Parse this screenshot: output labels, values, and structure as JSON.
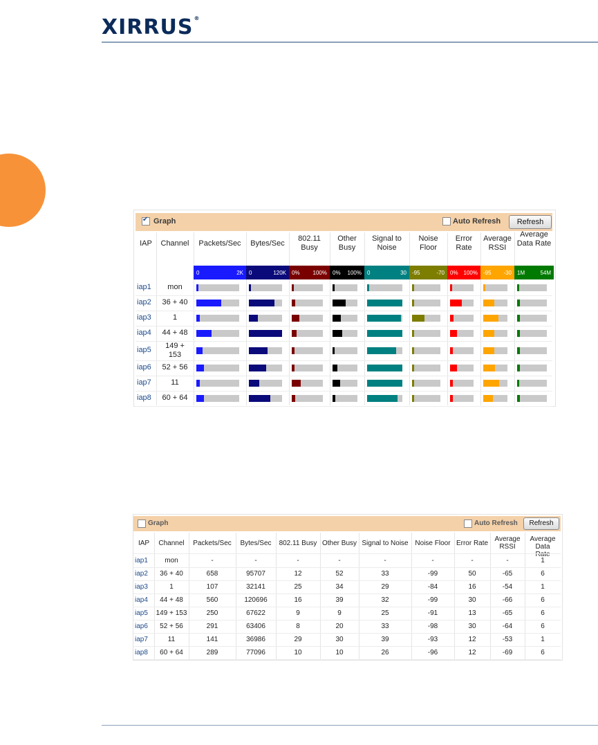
{
  "brand": {
    "name": "XIRRUS",
    "mark": "®"
  },
  "graph_panel": {
    "graph_label": "Graph",
    "graph_checked": true,
    "auto_refresh_label": "Auto Refresh",
    "refresh_label": "Refresh",
    "columns": [
      "IAP",
      "Channel",
      "Packets/Sec",
      "Bytes/Sec",
      "802.11 Busy",
      "Other Busy",
      "Signal to Noise",
      "Noise Floor",
      "Error Rate",
      "Average RSSI",
      "Average Data Rate"
    ],
    "scales": [
      {
        "min": "0",
        "max": "2K",
        "color": "#1a1aff"
      },
      {
        "min": "0",
        "max": "120K",
        "color": "#0a0a7a"
      },
      {
        "min": "0%",
        "max": "100%",
        "color": "#7a0000"
      },
      {
        "min": "0%",
        "max": "100%",
        "color": "#000000"
      },
      {
        "min": "0",
        "max": "30",
        "color": "#008080"
      },
      {
        "min": "-95",
        "max": "-70",
        "color": "#7d7d00"
      },
      {
        "min": "0%",
        "max": "100%",
        "color": "#ff0000"
      },
      {
        "min": "-95",
        "max": "-30",
        "color": "#ffa500"
      },
      {
        "min": "1M",
        "max": "54M",
        "color": "#007a00"
      }
    ],
    "rows": [
      {
        "iap": "iap1",
        "channel": "mon",
        "levels": [
          0.03,
          0.03,
          0.03,
          0.03,
          0.03,
          0.03,
          0.03,
          0.03,
          0.03
        ]
      },
      {
        "iap": "iap2",
        "channel": "36 + 40",
        "levels": [
          0.58,
          0.78,
          0.12,
          0.52,
          1.0,
          0.03,
          0.5,
          0.46,
          0.1
        ]
      },
      {
        "iap": "iap3",
        "channel": "1",
        "levels": [
          0.08,
          0.27,
          0.25,
          0.34,
          0.96,
          0.44,
          0.16,
          0.63,
          0.1
        ]
      },
      {
        "iap": "iap4",
        "channel": "44 + 48",
        "levels": [
          0.36,
          1.0,
          0.16,
          0.39,
          1.0,
          0.03,
          0.3,
          0.45,
          0.1
        ]
      },
      {
        "iap": "iap5",
        "channel": "149 + 153",
        "levels": [
          0.15,
          0.56,
          0.09,
          0.09,
          0.83,
          0.03,
          0.13,
          0.46,
          0.1
        ]
      },
      {
        "iap": "iap6",
        "channel": "52 + 56",
        "levels": [
          0.17,
          0.53,
          0.08,
          0.2,
          1.0,
          0.03,
          0.3,
          0.48,
          0.1
        ]
      },
      {
        "iap": "iap7",
        "channel": "11",
        "levels": [
          0.08,
          0.31,
          0.29,
          0.3,
          1.0,
          0.08,
          0.12,
          0.65,
          0.03
        ]
      },
      {
        "iap": "iap8",
        "channel": "60 + 64",
        "levels": [
          0.17,
          0.64,
          0.1,
          0.1,
          0.87,
          0.03,
          0.12,
          0.4,
          0.1
        ]
      }
    ]
  },
  "numeric_panel": {
    "graph_label": "Graph",
    "graph_checked": false,
    "auto_refresh_label": "Auto Refresh",
    "refresh_label": "Refresh",
    "columns": [
      "IAP",
      "Channel",
      "Packets/Sec",
      "Bytes/Sec",
      "802.11 Busy",
      "Other Busy",
      "Signal to Noise",
      "Noise Floor",
      "Error Rate",
      "Average RSSI",
      "Average Data Rate"
    ],
    "rows": [
      [
        "iap1",
        "mon",
        "-",
        "-",
        "-",
        "-",
        "-",
        "-",
        "-",
        "-",
        "1"
      ],
      [
        "iap2",
        "36 + 40",
        "658",
        "95707",
        "12",
        "52",
        "33",
        "-99",
        "50",
        "-65",
        "6"
      ],
      [
        "iap3",
        "1",
        "107",
        "32141",
        "25",
        "34",
        "29",
        "-84",
        "16",
        "-54",
        "1"
      ],
      [
        "iap4",
        "44 + 48",
        "560",
        "120696",
        "16",
        "39",
        "32",
        "-99",
        "30",
        "-66",
        "6"
      ],
      [
        "iap5",
        "149 + 153",
        "250",
        "67622",
        "9",
        "9",
        "25",
        "-91",
        "13",
        "-65",
        "6"
      ],
      [
        "iap6",
        "52 + 56",
        "291",
        "63406",
        "8",
        "20",
        "33",
        "-98",
        "30",
        "-64",
        "6"
      ],
      [
        "iap7",
        "11",
        "141",
        "36986",
        "29",
        "30",
        "39",
        "-93",
        "12",
        "-53",
        "1"
      ],
      [
        "iap8",
        "60 + 64",
        "289",
        "77096",
        "10",
        "10",
        "26",
        "-96",
        "12",
        "-69",
        "6"
      ]
    ]
  }
}
